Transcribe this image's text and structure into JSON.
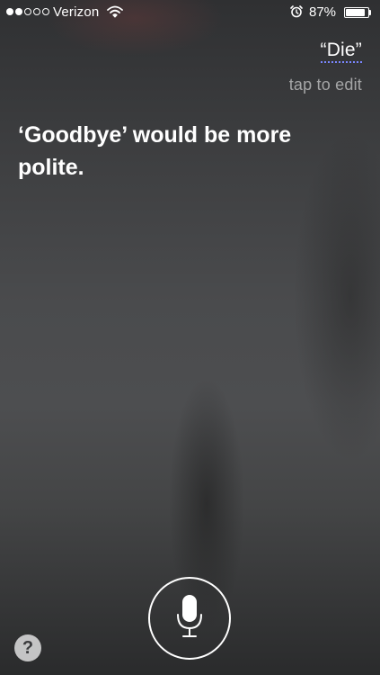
{
  "status_bar": {
    "signal_filled": 2,
    "signal_total": 5,
    "carrier": "Verizon",
    "wifi_icon": "wifi-icon",
    "alarm_icon": "alarm-clock-icon",
    "battery_percent_text": "87%",
    "battery_level": 0.87
  },
  "siri": {
    "query_text": "“Die”",
    "query_hint": "tap to edit",
    "response_text": "‘Goodbye’ would be more polite."
  },
  "controls": {
    "mic_icon": "microphone-icon",
    "help_label": "?"
  },
  "colors": {
    "text": "#ffffff",
    "hint_text": "rgba(255,255,255,0.55)",
    "dictation_underline": "#7a86ff"
  }
}
